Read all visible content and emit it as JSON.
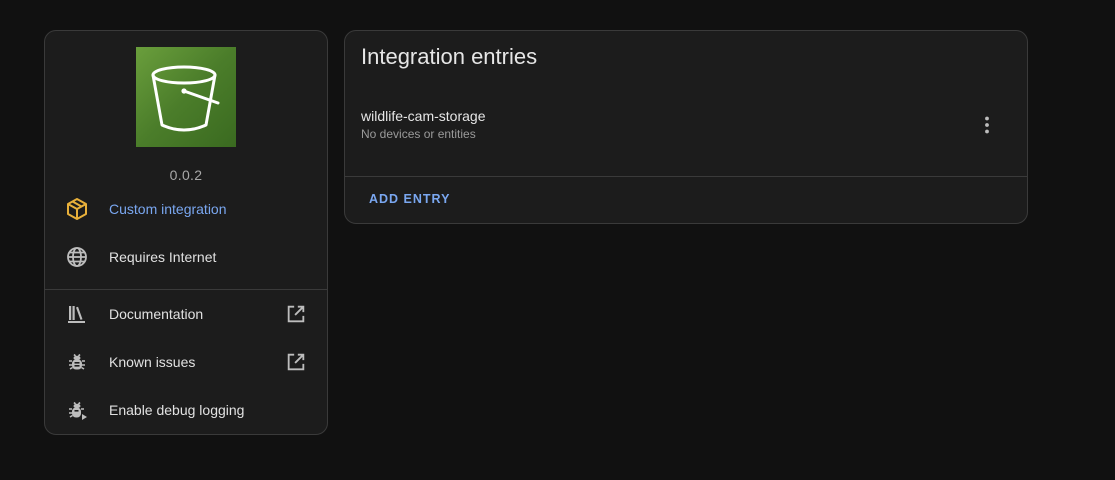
{
  "info": {
    "version": "0.0.2",
    "custom_integration": "Custom integration",
    "requires_internet": "Requires Internet",
    "documentation": "Documentation",
    "known_issues": "Known issues",
    "enable_debug_logging": "Enable debug logging"
  },
  "entries": {
    "title": "Integration entries",
    "items": [
      {
        "name": "wildlife-cam-storage",
        "subtitle": "No devices or entities"
      }
    ],
    "add_entry": "ADD ENTRY"
  },
  "colors": {
    "background": "#111111",
    "card": "#1c1c1c",
    "accent": "#7aa7f0",
    "custom_icon": "#e8b03a",
    "logo_green": "#5a8f32"
  },
  "icons": {
    "logo": "s3-bucket-icon",
    "custom": "package-icon",
    "internet": "globe-icon",
    "docs": "bookshelf-icon",
    "issues": "bug-icon",
    "debug": "bug-play-icon",
    "external": "open-in-new-icon",
    "menu": "dots-vertical-icon"
  }
}
